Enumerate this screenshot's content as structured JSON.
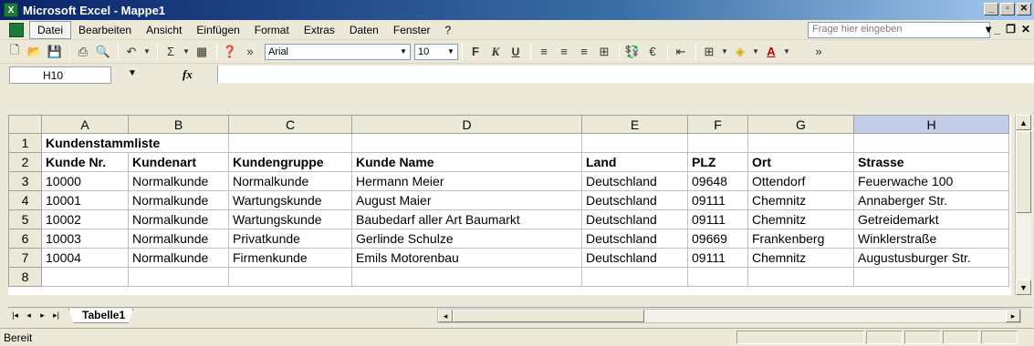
{
  "window": {
    "title": "Microsoft Excel - Mappe1",
    "app_icon": "excel-icon",
    "controls": [
      "minimize-icon",
      "restore-icon",
      "close-icon"
    ]
  },
  "menu": {
    "items": [
      "Datei",
      "Bearbeiten",
      "Ansicht",
      "Einfügen",
      "Format",
      "Extras",
      "Daten",
      "Fenster",
      "?"
    ],
    "active": "Datei",
    "help_placeholder": "Frage hier eingeben"
  },
  "toolbar": {
    "font_name": "Arial",
    "font_size": "10",
    "bold_label": "F",
    "italic_label": "K",
    "underline_label": "U",
    "sum_label": "Σ",
    "euro_label": "€"
  },
  "formula_bar": {
    "name_box": "H10",
    "fx_label": "fx",
    "content": ""
  },
  "sheet": {
    "columns": [
      "A",
      "B",
      "C",
      "D",
      "E",
      "F",
      "G",
      "H"
    ],
    "selected_column": "H",
    "rows": [
      {
        "num": "1",
        "cells": [
          "Kundenstammliste",
          "",
          "",
          "",
          "",
          "",
          "",
          ""
        ]
      },
      {
        "num": "2",
        "cells": [
          "Kunde Nr.",
          "Kundenart",
          "Kundengruppe",
          "Kunde Name",
          "Land",
          "PLZ",
          "Ort",
          "Strasse"
        ]
      },
      {
        "num": "3",
        "cells": [
          "10000",
          "Normalkunde",
          "Normalkunde",
          "Hermann Meier",
          "Deutschland",
          "09648",
          "Ottendorf",
          "Feuerwache 100"
        ]
      },
      {
        "num": "4",
        "cells": [
          "10001",
          "Normalkunde",
          "Wartungskunde",
          "August Maier",
          "Deutschland",
          "09111",
          "Chemnitz",
          "Annaberger Str."
        ]
      },
      {
        "num": "5",
        "cells": [
          "10002",
          "Normalkunde",
          "Wartungskunde",
          "Baubedarf aller Art  Baumarkt",
          "Deutschland",
          "09111",
          "Chemnitz",
          "Getreidemarkt"
        ]
      },
      {
        "num": "6",
        "cells": [
          "10003",
          "Normalkunde",
          "Privatkunde",
          "Gerlinde Schulze",
          "Deutschland",
          "09669",
          "Frankenberg",
          "Winklerstraße"
        ]
      },
      {
        "num": "7",
        "cells": [
          "10004",
          "Normalkunde",
          "Firmenkunde",
          "Emils Motorenbau",
          "Deutschland",
          "09111",
          "Chemnitz",
          "Augustusburger Str."
        ]
      },
      {
        "num": "8",
        "cells": [
          "",
          "",
          "",
          "",
          "",
          "",
          "",
          ""
        ]
      }
    ],
    "tab_name": "Tabelle1"
  },
  "status": {
    "text": "Bereit"
  }
}
